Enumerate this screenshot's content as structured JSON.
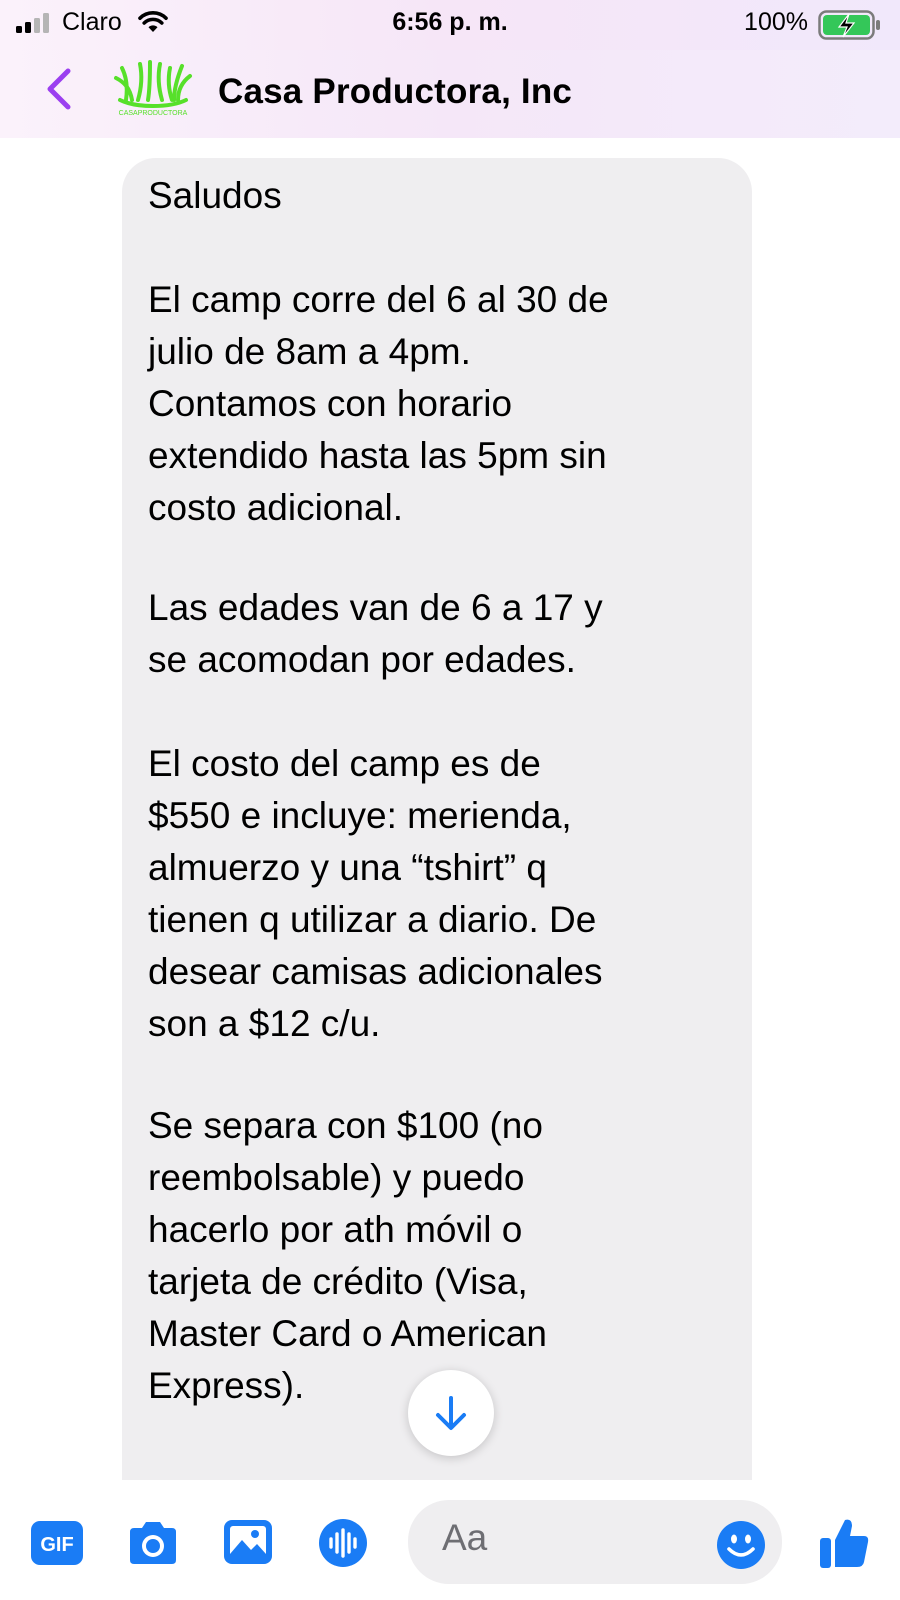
{
  "status_bar": {
    "carrier": "Claro",
    "time": "6:56 p. m.",
    "battery_percent": "100%"
  },
  "header": {
    "title": "Casa Productora, Inc",
    "logo_text": "CASAPRODUCTORA",
    "accent_color": "#9b3ff0",
    "logo_color": "#57e02a"
  },
  "message": {
    "paragraphs": [
      "Saludos",
      "El camp corre del 6 al 30 de\njulio de 8am a 4pm.\nContamos con horario\nextendido hasta las 5pm sin\ncosto adicional.",
      "Las edades van de 6 a 17 y\nse acomodan por edades.",
      "El costo del camp es de\n$550 e incluye: merienda,\nalmuerzo y una “tshirt” q\ntienen q utilizar a diario. De\ndesear camisas adicionales\nson a $12 c/u.",
      "Se separa con $100 (no\nreembolsable) y puedo\nhacerlo por ath móvil o\ntarjeta de crédito (Visa,\nMaster Card o American\nExpress).",
      ""
    ]
  },
  "composer": {
    "placeholder": "Aa",
    "icon_color": "#1a7cf5",
    "gif_label": "GIF",
    "icons": [
      "gif-icon",
      "camera-icon",
      "photo-icon",
      "mic-icon",
      "emoji-icon",
      "like-icon"
    ]
  }
}
